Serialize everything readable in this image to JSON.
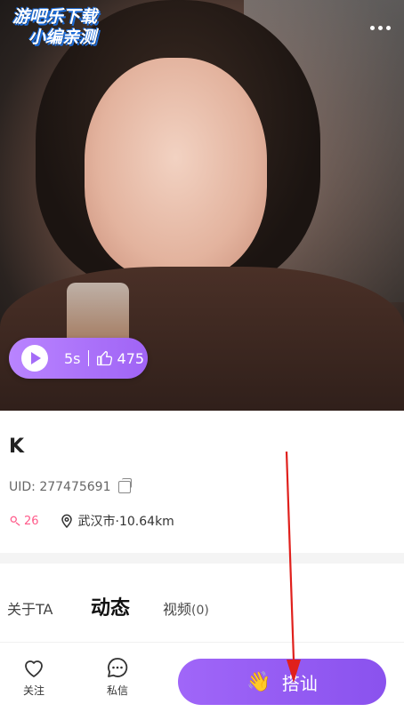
{
  "watermark": {
    "line1": "游吧乐下载",
    "line2": "小编亲测"
  },
  "video_badge": {
    "duration": "5s",
    "likes": "475"
  },
  "profile": {
    "name": "K",
    "uid_label": "UID: 277475691",
    "fans": "26",
    "location": "武汉市·10.64km"
  },
  "tabs": [
    {
      "label": "关于TA"
    },
    {
      "label": "动态"
    },
    {
      "label": "视频",
      "count": "(0)"
    }
  ],
  "bottom_bar": {
    "follow_label": "关注",
    "message_label": "私信",
    "greet_label": "搭讪"
  },
  "colors": {
    "accent_purple": "#9a5ef4",
    "fans_pink": "#ff5a8a",
    "annotation_red": "#e0201c"
  }
}
